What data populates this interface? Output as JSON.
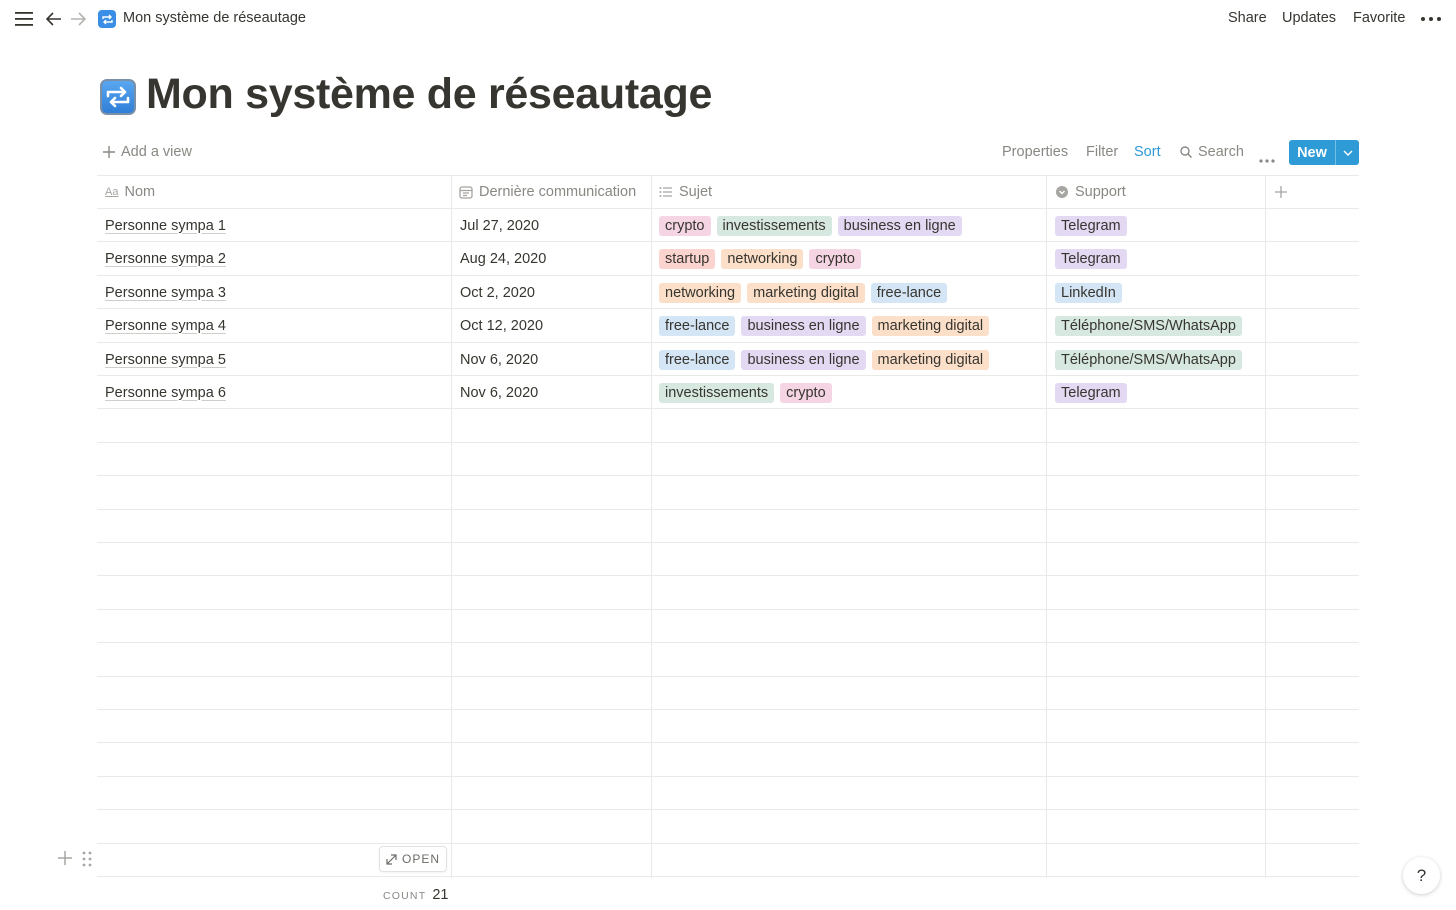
{
  "topbar": {
    "breadcrumb_title": "Mon système de réseautage",
    "share_label": "Share",
    "updates_label": "Updates",
    "favorite_label": "Favorite"
  },
  "page": {
    "title": "Mon système de réseautage",
    "icon": "repeat-arrows-emoji"
  },
  "viewbar": {
    "add_view_label": "Add a view",
    "properties_label": "Properties",
    "filter_label": "Filter",
    "sort_label": "Sort",
    "search_label": "Search",
    "new_label": "New"
  },
  "table": {
    "columns": [
      {
        "label": "Nom",
        "icon": "title-aa-icon"
      },
      {
        "label": "Dernière communication",
        "icon": "calendar-icon"
      },
      {
        "label": "Sujet",
        "icon": "list-icon"
      },
      {
        "label": "Support",
        "icon": "select-icon"
      }
    ],
    "rows": [
      {
        "name": "Personne sympa 1",
        "date": "Jul 27, 2020",
        "sujet": [
          "crypto",
          "investissements",
          "business en ligne"
        ],
        "support": "Telegram"
      },
      {
        "name": "Personne sympa 2",
        "date": "Aug 24, 2020",
        "sujet": [
          "startup",
          "networking",
          "crypto"
        ],
        "support": "Telegram"
      },
      {
        "name": "Personne sympa 3",
        "date": "Oct 2, 2020",
        "sujet": [
          "networking",
          "marketing digital",
          "free-lance"
        ],
        "support": "LinkedIn"
      },
      {
        "name": "Personne sympa 4",
        "date": "Oct 12, 2020",
        "sujet": [
          "free-lance",
          "business en ligne",
          "marketing digital"
        ],
        "support": "Téléphone/SMS/WhatsApp"
      },
      {
        "name": "Personne sympa 5",
        "date": "Nov 6, 2020",
        "sujet": [
          "free-lance",
          "business en ligne",
          "marketing digital"
        ],
        "support": "Téléphone/SMS/WhatsApp"
      },
      {
        "name": "Personne sympa 6",
        "date": "Nov 6, 2020",
        "sujet": [
          "investissements",
          "crypto"
        ],
        "support": "Telegram"
      }
    ],
    "open_label": "OPEN",
    "count_label": "COUNT",
    "count_value": "21"
  },
  "tag_colors": {
    "crypto": "#f5d4e3",
    "investissements": "#d6e8df",
    "business en ligne": "#e4d9f3",
    "startup": "#fbd3cf",
    "networking": "#fbdfc9",
    "marketing digital": "#fbdfc9",
    "free-lance": "#d4e5f5",
    "Telegram": "#e4d9f3",
    "LinkedIn": "#d4e5f5",
    "Téléphone/SMS/WhatsApp": "#d6e8df"
  },
  "accent_color": "#2e9bd6",
  "help_label": "?"
}
